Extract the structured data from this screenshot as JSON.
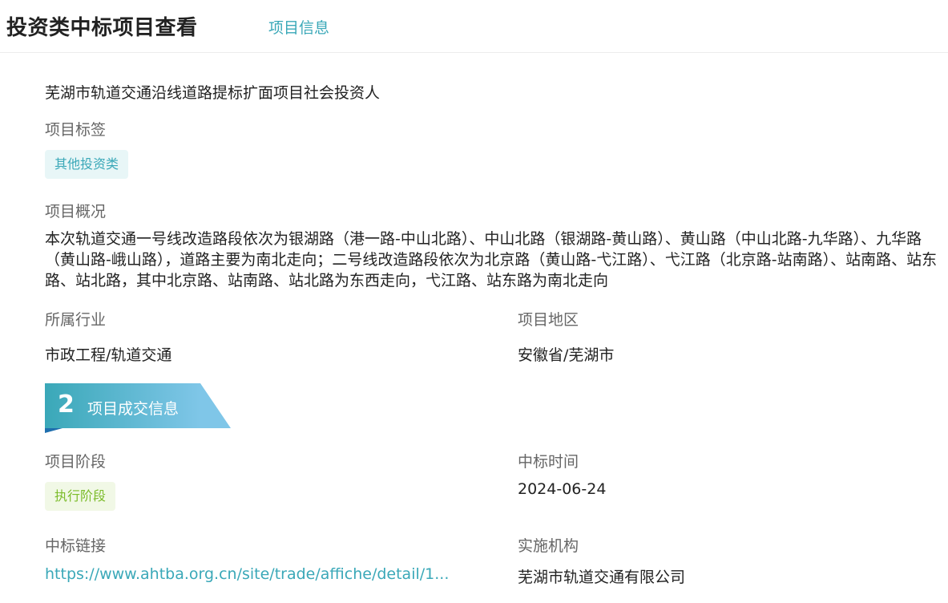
{
  "header": {
    "title": "投资类中标项目查看",
    "tab_label": "项目信息"
  },
  "project": {
    "name": "芜湖市轨道交通沿线道路提标扩面项目社会投资人",
    "tags_label": "项目标签",
    "tag": "其他投资类",
    "overview_label": "项目概况",
    "overview": "本次轨道交通一号线改造路段依次为银湖路（港一路-中山北路）、中山北路（银湖路-黄山路）、黄山路（中山北路-九华路）、九华路（黄山路-峨山路），道路主要为南北走向；二号线改造路段依次为北京路（黄山路-弋江路）、弋江路（北京路-站南路）、站南路、站东路、站北路，其中北京路、站南路、站北路为东西走向，弋江路、站东路为南北走向",
    "industry_label": "所属行业",
    "industry": "市政工程/轨道交通",
    "region_label": "项目地区",
    "region": "安徽省/芜湖市"
  },
  "section2": {
    "number": "2",
    "title": "项目成交信息",
    "stage_label": "项目阶段",
    "stage": "执行阶段",
    "bid_time_label": "中标时间",
    "bid_time": "2024-06-24",
    "link_label": "中标链接",
    "link": "https://www.ahtba.org.cn/site/trade/affiche/detail/1...",
    "agency_label": "实施机构",
    "agency": "芜湖市轨道交通有限公司"
  },
  "colors": {
    "accent": "#3aa8b8",
    "banner_dark": "#3aa8b8",
    "banner_light": "#7fc6e8",
    "stage_green": "#7cbc2b"
  }
}
